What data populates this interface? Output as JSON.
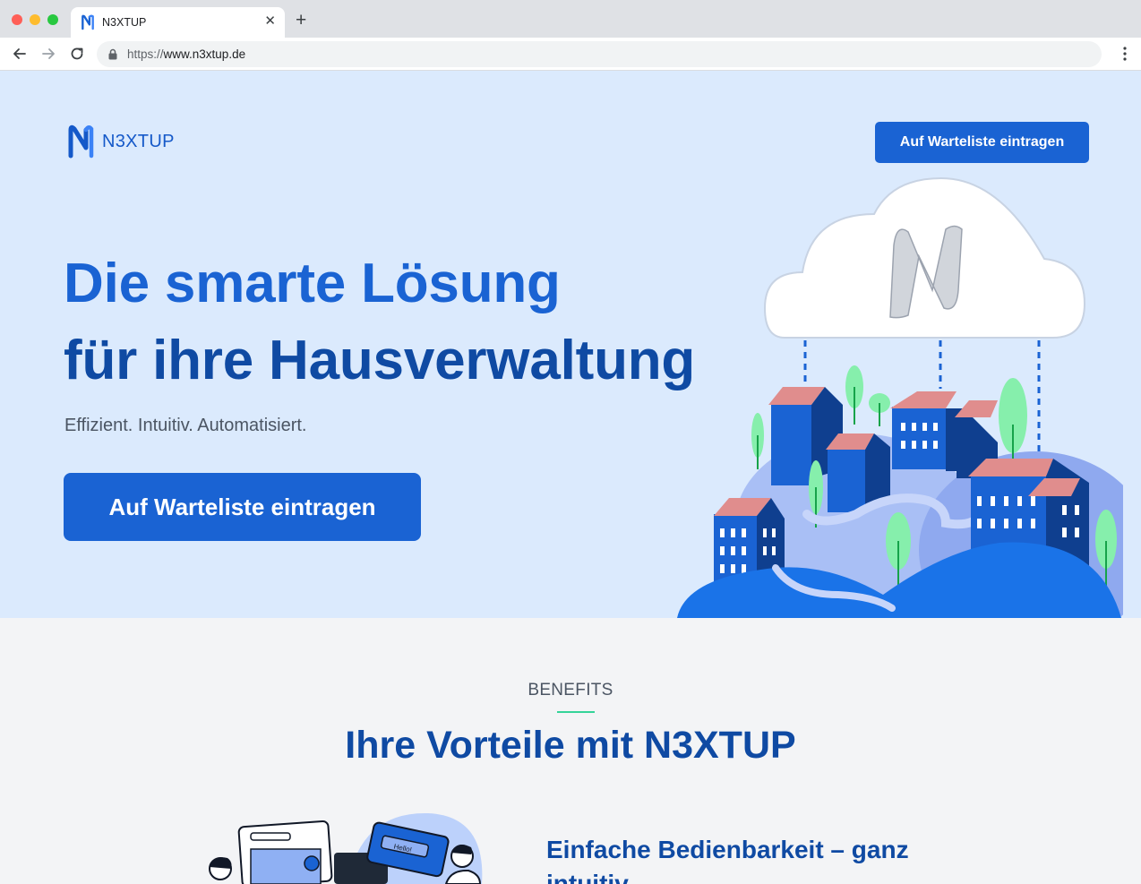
{
  "browser": {
    "tab_title": "N3XTUP",
    "url_scheme": "https://",
    "url_host": "www.n3xtup.de",
    "new_tab_symbol": "+",
    "close_symbol": "✕"
  },
  "header": {
    "brand": "N3XTUP",
    "cta_label": "Auf Warteliste eintragen"
  },
  "hero": {
    "title_line1": "Die smarte Lösung",
    "title_line2": "für ihre Hausverwaltung",
    "subtitle": "Effizient. Intuitiv. Automatisiert.",
    "cta_label": "Auf Warteliste eintragen",
    "illustration_badge": "Hello!"
  },
  "benefits": {
    "eyebrow": "BENEFITS",
    "title": "Ihre Vorteile mit N3XTUP",
    "items": [
      {
        "heading": "Einfache Bedienbarkeit – ganz intuitiv"
      }
    ]
  },
  "colors": {
    "primary": "#1a63d3",
    "primary_dark": "#0f4aa3",
    "hero_bg": "#dbeafd",
    "section_bg": "#f3f4f6",
    "accent_green": "#34d399",
    "roof_pink": "#e08d8d"
  }
}
